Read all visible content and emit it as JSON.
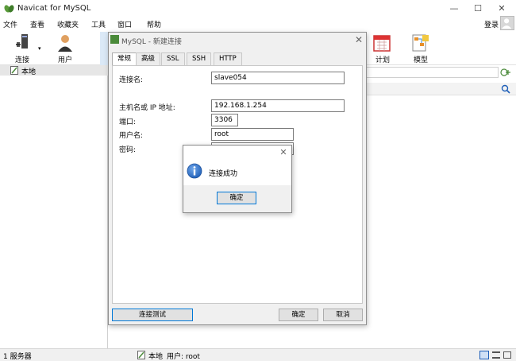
{
  "window": {
    "title": "Navicat for MySQL",
    "minimize": "—",
    "maximize": "☐",
    "close": "✕"
  },
  "menu": {
    "items": [
      "文件",
      "查看",
      "收藏夹",
      "工具",
      "窗口",
      "帮助"
    ],
    "login": "登录"
  },
  "toolbar": {
    "connect": "连接",
    "user": "用户",
    "schedule": "计划",
    "model": "模型"
  },
  "tree": {
    "root": "本地"
  },
  "connection_dialog": {
    "title": "MySQL - 新建连接",
    "tabs": [
      "常规",
      "高级",
      "SSL",
      "SSH",
      "HTTP"
    ],
    "fields": {
      "conn_name_label": "连接名:",
      "conn_name_value": "slave054",
      "host_label": "主机名或 IP 地址:",
      "host_value": "192.168.1.254",
      "port_label": "端口:",
      "port_value": "3306",
      "user_label": "用户名:",
      "user_value": "root",
      "password_label": "密码:",
      "password_value": "●●●●●●"
    },
    "test_button": "连接测试",
    "ok_button": "确定",
    "cancel_button": "取消"
  },
  "message_box": {
    "text": "连接成功",
    "ok_button": "确定",
    "close": "✕"
  },
  "statusbar": {
    "servers": "1 服务器",
    "location": "本地",
    "user": "用户: root"
  },
  "colors": {
    "accent": "#0078d7",
    "info_icon": "#1f5fb8",
    "navicat_green": "#4a8a3a"
  }
}
